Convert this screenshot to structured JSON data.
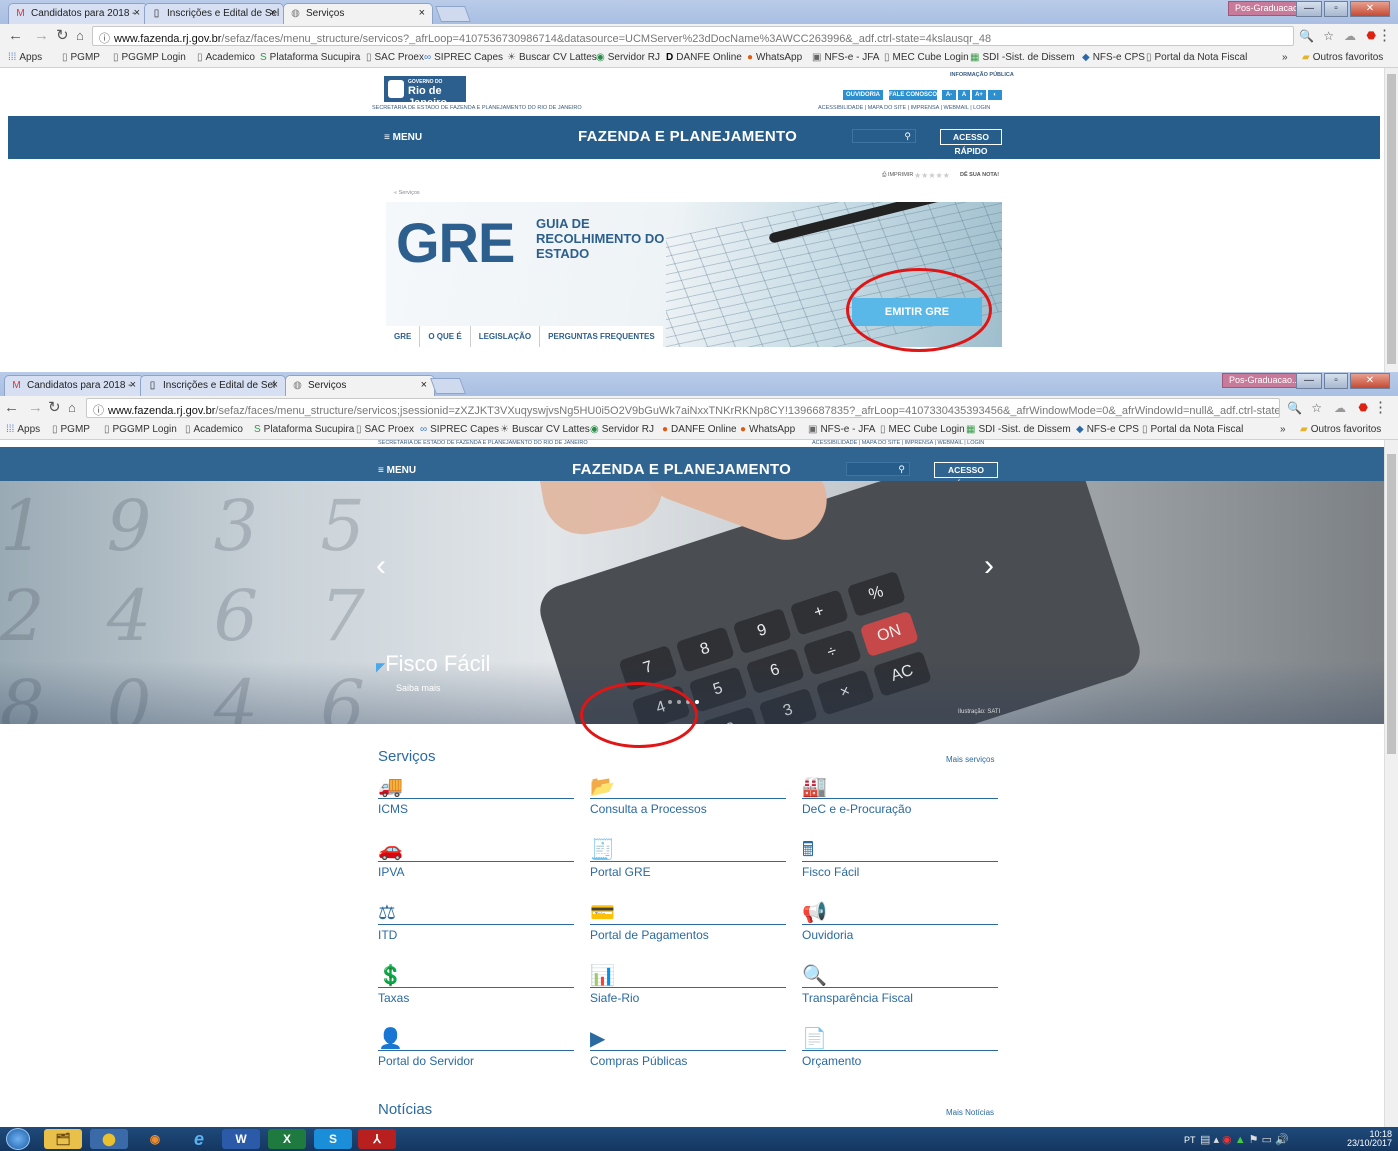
{
  "browser1": {
    "tabs": [
      "Candidatos para 2018 - ",
      "Inscrições e Edital de Sel",
      "Serviços"
    ],
    "profile": "Pos-Graduacao...",
    "url_host": "www.fazenda.rj.gov.br",
    "url_path": "/sefaz/faces/menu_structure/servicos?_afrLoop=4107536730986714&datasource=UCMServer%23dDocName%3AWCC263996&_adf.ctrl-state=4kslausqr_48"
  },
  "browser2": {
    "tabs": [
      "Candidatos para 2018 - ",
      "Inscrições e Edital de Sel",
      "Serviços"
    ],
    "profile": "Pos-Graduacao...",
    "url_host": "www.fazenda.rj.gov.br",
    "url_path": "/sefaz/faces/menu_structure/servicos;jsessionid=zXZJKT3VXuqyswjvsNg5HU0i5O2V9bGuWk7aiNxxTNKrRKNp8CY!1396687835?_afrLoop=4107330435393456&_afrWindowMode=0&_afrWindowId=null&_adf.ctrl-state=4kslausqr_1"
  },
  "bookmarks": [
    "Apps",
    "PGMP",
    "PGGMP Login",
    "Academico",
    "Plataforma Sucupira",
    "SAC Proex",
    "SIPREC Capes",
    "Buscar CV Lattes",
    "Servidor RJ",
    "DANFE Online",
    "WhatsApp",
    "NFS-e - JFA",
    "MEC Cube Login",
    "SDI -Sist. de Dissem",
    "NFS-e CPS",
    "Portal da Nota Fiscal",
    "»",
    "Outros favoritos"
  ],
  "site": {
    "gov_small": "GOVERNO DO",
    "gov_big": "Rio de Janeiro",
    "secretaria": "SECRETARIA DE ESTADO DE FAZENDA E PLANEJAMENTO DO RIO DE JANEIRO",
    "info_publica": "INFORMAÇÃO PÚBLICA",
    "ouvidoria": "OUVIDORIA",
    "fale": "FALE CONOSCO",
    "font_btns": [
      "A-",
      "A",
      "A+",
      "◐"
    ],
    "links": "ACESSIBILIDADE | MAPA DO SITE | IMPRENSA | WEBMAIL | LOGIN",
    "menu": "≡ MENU",
    "title": "FAZENDA E PLANEJAMENTO",
    "acesso": "ACESSO RÁPIDO",
    "imprimir": "IMPRIMIR",
    "nota": "DÊ SUA NOTA!",
    "breadcrumb": "« Serviços"
  },
  "gre": {
    "big": "GRE",
    "sub": "GUIA DE RECOLHIMENTO DO ESTADO",
    "emitir": "EMITIR GRE",
    "tabs": [
      "GRE",
      "O QUE É",
      "LEGISLAÇÃO",
      "PERGUNTAS FREQUENTES"
    ]
  },
  "hero": {
    "title": "Fisco Fácil",
    "subtitle": "Saiba mais",
    "credit": "Ilustração: SATI",
    "numbers": "1 9 3 5 2 4 6 7 8 0 4 6 5 9 8 7 2 3"
  },
  "services": {
    "title": "Serviços",
    "more": "Mais serviços",
    "items": [
      {
        "label": "ICMS",
        "icon": "🚚"
      },
      {
        "label": "Consulta a Processos",
        "icon": "📂"
      },
      {
        "label": "DeC e e-Procuração",
        "icon": "🏭"
      },
      {
        "label": "IPVA",
        "icon": "🚗"
      },
      {
        "label": "Portal GRE",
        "icon": "🧾"
      },
      {
        "label": "Fisco Fácil",
        "icon": "🖩"
      },
      {
        "label": "ITD",
        "icon": "⚖"
      },
      {
        "label": "Portal de Pagamentos",
        "icon": "💳"
      },
      {
        "label": "Ouvidoria",
        "icon": "📢"
      },
      {
        "label": "Taxas",
        "icon": "💲"
      },
      {
        "label": "Siafe-Rio",
        "icon": "📊"
      },
      {
        "label": "Transparência Fiscal",
        "icon": "🔍"
      },
      {
        "label": "Portal do Servidor",
        "icon": "👤"
      },
      {
        "label": "Compras Públicas",
        "icon": "▶"
      },
      {
        "label": "Orçamento",
        "icon": "📄"
      }
    ]
  },
  "news": {
    "title": "Notícias",
    "more": "Mais Notícias"
  },
  "taskbar": {
    "lang": "PT",
    "time": "10:18",
    "date": "23/10/2017",
    "apps": [
      "🗂",
      "⬤",
      "◉",
      "e",
      "W",
      "X",
      "S",
      "⅄"
    ]
  }
}
